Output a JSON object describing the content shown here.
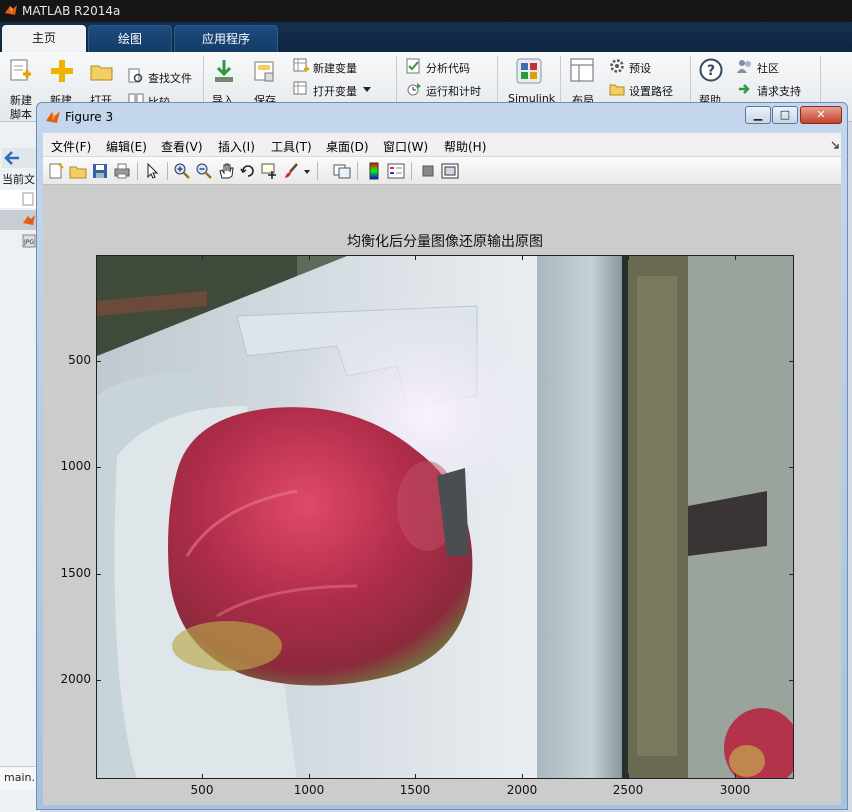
{
  "app": {
    "title": "MATLAB R2014a"
  },
  "main_tabs": [
    {
      "label": "主页",
      "active": true
    },
    {
      "label": "绘图",
      "active": false
    },
    {
      "label": "应用程序",
      "active": false
    }
  ],
  "ribbon": {
    "new_script": [
      "新建",
      "脚本"
    ],
    "new": "新建",
    "open": "打开",
    "find_files": "查找文件",
    "compare": "比较",
    "import": "导入",
    "save": "保存",
    "new_variable": "新建变量",
    "open_variable": "打开变量",
    "analyze_code": "分析代码",
    "run_and_time": "运行和计时",
    "simulink": "Simulink",
    "layout": "布局",
    "preferences": "预设",
    "set_path": "设置路径",
    "help": "帮助",
    "community": "社区",
    "request_support": "请求支持"
  },
  "left_panel": {
    "current_folder": "当前文",
    "status": "main."
  },
  "figure": {
    "title": "Figure 3",
    "menu": [
      "文件(F)",
      "编辑(E)",
      "查看(V)",
      "插入(I)",
      "工具(T)",
      "桌面(D)",
      "窗口(W)",
      "帮助(H)"
    ],
    "toolbar_icons": [
      "new-figure-icon",
      "open-file-icon",
      "save-icon",
      "print-icon",
      "pointer-icon",
      "zoom-in-icon",
      "zoom-out-icon",
      "pan-icon",
      "rotate-3d-icon",
      "data-cursor-icon",
      "brush-icon",
      "link-plot-icon",
      "colorbar-icon",
      "legend-icon",
      "hide-plot-tools-icon",
      "show-plot-tools-icon"
    ],
    "axes_title": "均衡化后分量图像还原输出原图",
    "y_ticks": [
      "500",
      "1000",
      "1500",
      "2000"
    ],
    "x_ticks": [
      "500",
      "1000",
      "1500",
      "2000",
      "2500",
      "3000"
    ]
  }
}
